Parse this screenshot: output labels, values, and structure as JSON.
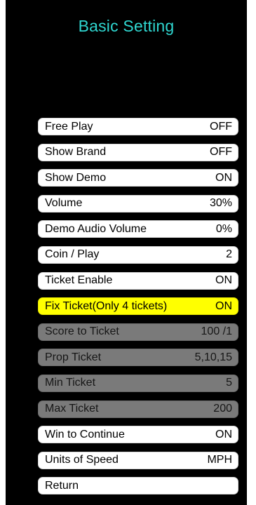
{
  "title": "Basic Setting",
  "colors": {
    "background": "#000000",
    "title": "#2fd6d0",
    "item_normal": "#ffffff",
    "item_selected": "#ffff00",
    "item_disabled": "#7a7a7a"
  },
  "menu": {
    "items": [
      {
        "label": "Free Play",
        "value": "OFF"
      },
      {
        "label": "Show Brand",
        "value": "OFF"
      },
      {
        "label": "Show Demo",
        "value": "ON"
      },
      {
        "label": "Volume",
        "value": "30%"
      },
      {
        "label": "Demo Audio Volume",
        "value": "0%"
      },
      {
        "label": "Coin / Play",
        "value": "2"
      },
      {
        "label": "Ticket Enable",
        "value": "ON"
      },
      {
        "label": "Fix Ticket(Only 4 tickets)",
        "value": "ON"
      },
      {
        "label": "Score to Ticket",
        "value": "100 /1"
      },
      {
        "label": "Prop Ticket",
        "value": "5,10,15"
      },
      {
        "label": "Min Ticket",
        "value": "5"
      },
      {
        "label": "Max Ticket",
        "value": "200"
      },
      {
        "label": "Win to Continue",
        "value": "ON"
      },
      {
        "label": "Units of Speed",
        "value": "MPH"
      },
      {
        "label": "Return",
        "value": ""
      }
    ]
  }
}
